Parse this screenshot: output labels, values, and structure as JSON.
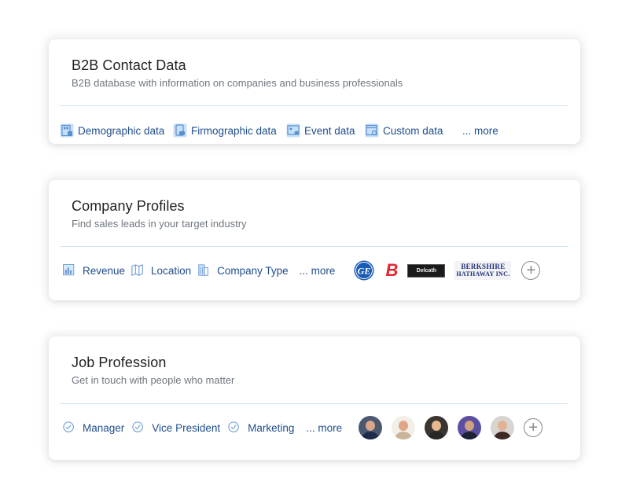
{
  "cards": [
    {
      "title": "B2B Contact Data",
      "subtitle": "B2B database with information on companies and business professionals",
      "items": [
        {
          "label": "Demographic data",
          "icon": "demographic-data-icon"
        },
        {
          "label": "Firmographic data",
          "icon": "firmographic-data-icon"
        },
        {
          "label": "Event data",
          "icon": "event-data-icon"
        },
        {
          "label": "Custom data",
          "icon": "custom-data-icon"
        }
      ],
      "more_label": "... more"
    },
    {
      "title": "Company Profiles",
      "subtitle": "Find sales leads in your target industry",
      "items": [
        {
          "label": "Revenue",
          "icon": "revenue-chart-icon"
        },
        {
          "label": "Location",
          "icon": "map-icon"
        },
        {
          "label": "Company Type",
          "icon": "building-icon"
        }
      ],
      "more_label": "... more",
      "logos": [
        {
          "name": "GE",
          "text": "GE",
          "color": "#1a5bb5"
        },
        {
          "name": "B",
          "text": "B",
          "color": "#e3262e"
        },
        {
          "name": "Delcath",
          "text": "Delcath",
          "color": "#1b1b1b"
        },
        {
          "name": "Berkshire Hathaway",
          "line1": "BERKSHIRE",
          "line2": "HATHAWAY INC.",
          "color": "#1f2f7a"
        }
      ]
    },
    {
      "title": "Job Profession",
      "subtitle": "Get in touch with people who matter",
      "items": [
        {
          "label": "Manager",
          "icon": "check-circle-icon"
        },
        {
          "label": "Vice President",
          "icon": "check-circle-icon"
        },
        {
          "label": "Marketing",
          "icon": "check-circle-icon"
        }
      ],
      "more_label": "... more",
      "avatars": [
        {
          "bg": "#4a5870",
          "skin": "#d9a68a",
          "shirt": "#1d2a4a"
        },
        {
          "bg": "#f2efe9",
          "skin": "#e0a588",
          "shirt": "#c9b49a"
        },
        {
          "bg": "#3a3530",
          "skin": "#e6b98e",
          "shirt": "#2a2623"
        },
        {
          "bg": "#5a4fa0",
          "skin": "#d1a27f",
          "shirt": "#1c2233"
        },
        {
          "bg": "#d8d4d0",
          "skin": "#e4b396",
          "shirt": "#3b2a24"
        }
      ]
    }
  ],
  "add_label": "+"
}
